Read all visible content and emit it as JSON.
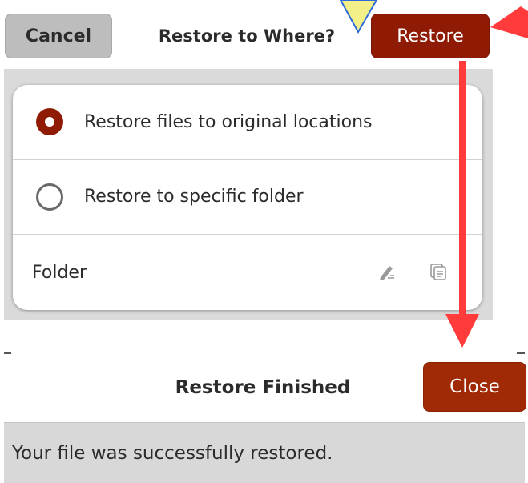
{
  "restore_dialog": {
    "title": "Restore to Where?",
    "cancel_label": "Cancel",
    "restore_label": "Restore",
    "options": [
      {
        "label": "Restore files to original locations",
        "selected": true
      },
      {
        "label": "Restore to specific folder",
        "selected": false
      }
    ],
    "folder_label": "Folder",
    "folder_icons": [
      "edit-icon",
      "copy-icon"
    ]
  },
  "finished_dialog": {
    "title": "Restore Finished",
    "close_label": "Close",
    "message": "Your file was successfully restored."
  },
  "colors": {
    "accent": "#8f1b05",
    "annotation_arrow": "#ff3b3b",
    "annotation_callout": "#f3f08a"
  }
}
